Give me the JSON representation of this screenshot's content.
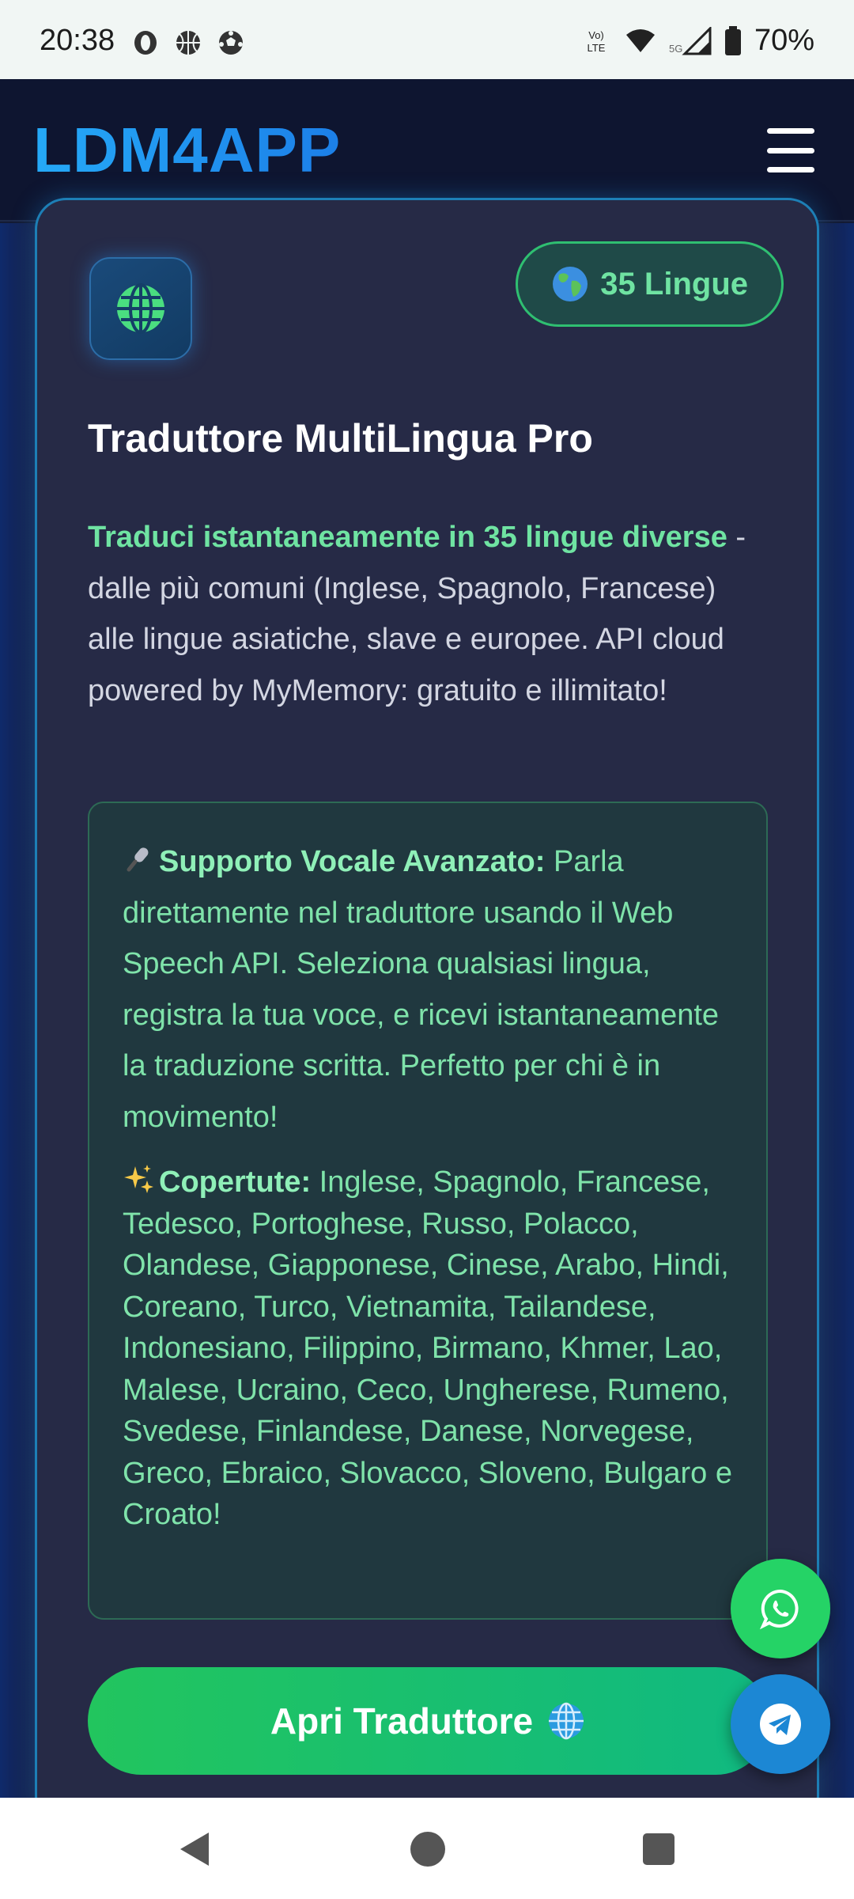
{
  "status_bar": {
    "time": "20:38",
    "battery": "70%",
    "network": "5G",
    "volte": "Vo LTE",
    "left_icons": [
      "opera-icon",
      "basketball-icon",
      "soccer-ball-icon"
    ]
  },
  "header": {
    "brand": "LDM4APP",
    "menu_icon": "hamburger-menu-icon"
  },
  "card": {
    "icon": "globe-icon",
    "badge": "35 Lingue",
    "title": "Traduttore MultiLingua Pro",
    "description_highlight": "Traduci istantaneamente in 35 lingue diverse",
    "description_rest": " - dalle più comuni (Inglese, Spagnolo, Francese) alle lingue asiatiche, slave e europee. API cloud powered by MyMemory: gratuito e illimitato!",
    "feature_voice_label": "Supporto Vocale Avanzato:",
    "feature_voice_text": " Parla direttamente nel traduttore usando il Web Speech API. Seleziona qualsiasi lingua, registra la tua voce, e ricevi istantaneamente la traduzione scritta. Perfetto per chi è in movimento!",
    "feature_languages_label": "Copertute:",
    "feature_languages_text": " Inglese, Spagnolo, Francese, Tedesco, Portoghese, Russo, Polacco, Olandese, Giapponese, Cinese, Arabo, Hindi, Coreano, Turco, Vietnamita, Tailandese, Indonesiano, Filippino, Birmano, Khmer, Lao, Malese, Ucraino, Ceco, Ungherese, Rumeno, Svedese, Finlandese, Danese, Norvegese, Greco, Ebraico, Slovacco, Sloveno, Bulgaro e Croato!",
    "open_button": "Apri Traduttore"
  },
  "fabs": {
    "whatsapp": "whatsapp-icon",
    "telegram": "telegram-icon"
  },
  "colors": {
    "brand": "#1e9cf5",
    "accent_green": "#22c55e",
    "card_border": "#1d7fb6",
    "highlight_text": "#6fe3a2"
  }
}
